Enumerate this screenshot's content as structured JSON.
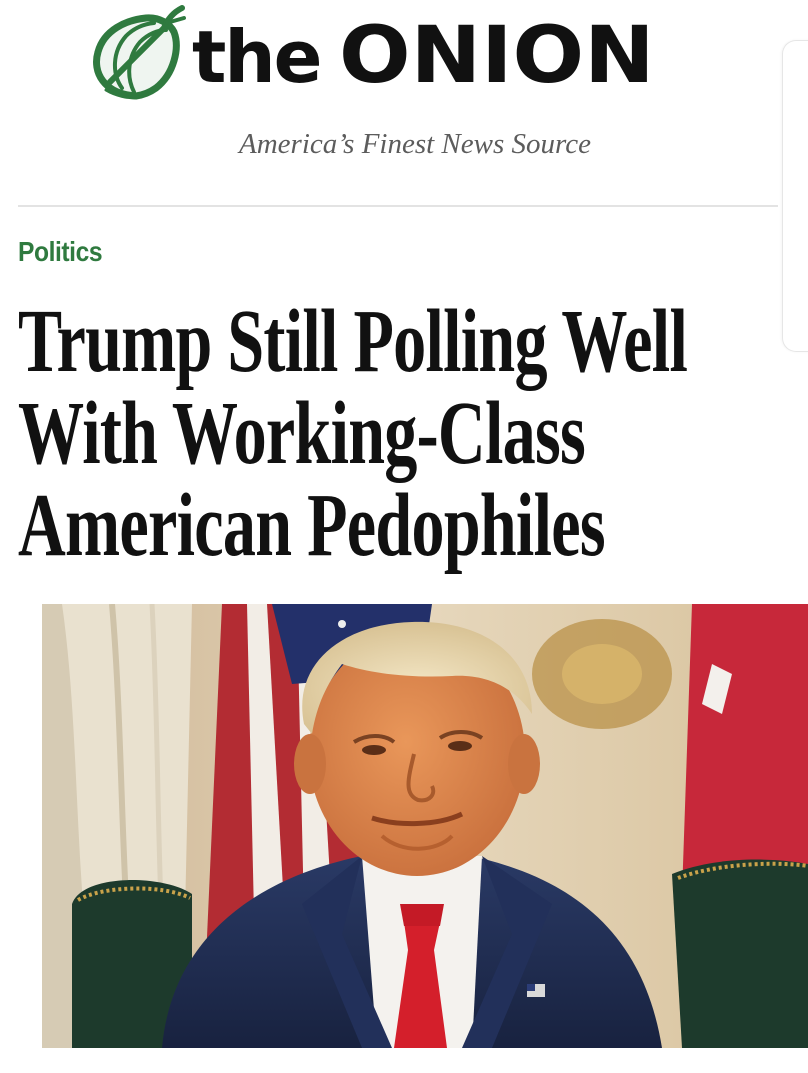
{
  "masthead": {
    "logo_the": "the",
    "logo_onion": "ONION",
    "tagline": "America’s Finest News Source",
    "logo_icon": "onion-logo-icon"
  },
  "article": {
    "category": "Politics",
    "headline_lines": [
      "Trump Still Polling Well",
      "With Working-Class",
      "American Pedophiles"
    ]
  },
  "colors": {
    "brand_green": "#2f7a3f",
    "text": "#111111",
    "tagline": "#5c5c5c"
  },
  "image": {
    "subject": "photo-of-man-in-suit-with-red-tie-in-front-of-flags"
  }
}
